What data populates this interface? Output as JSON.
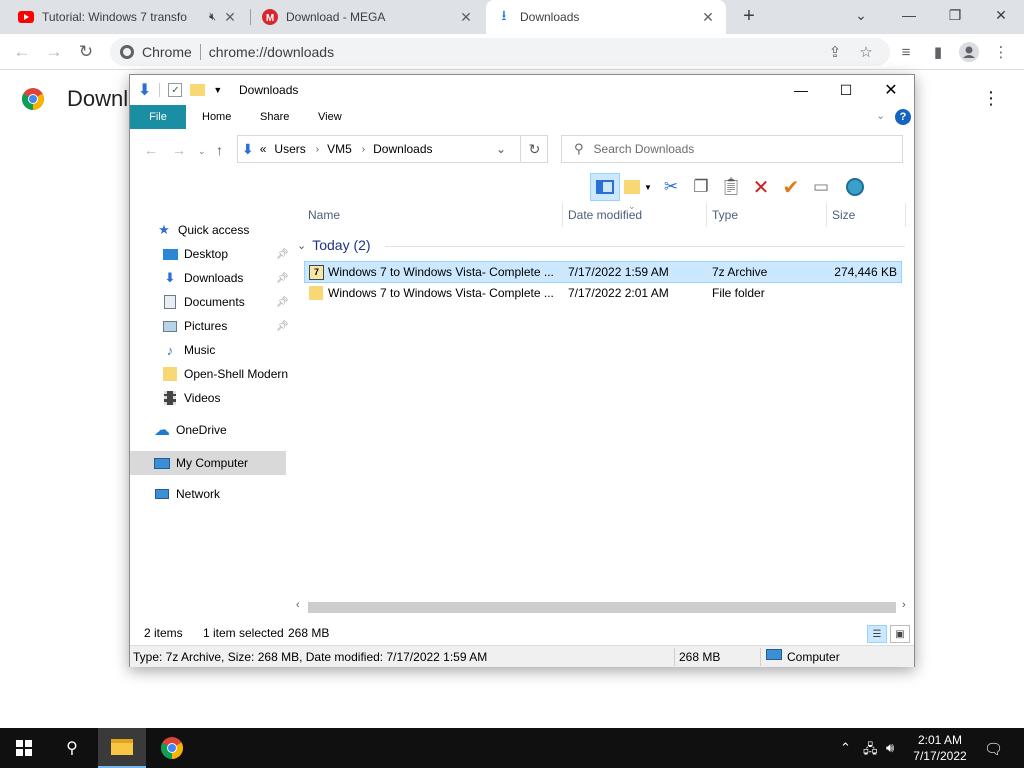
{
  "browser": {
    "tabs": [
      {
        "title": "Tutorial: Windows 7 transfo",
        "icon": "youtube-icon",
        "muted": true
      },
      {
        "title": "Download - MEGA",
        "icon": "mega-icon"
      },
      {
        "title": "Downloads",
        "icon": "download-icon",
        "active": true
      }
    ],
    "omnibox": {
      "site": "Chrome",
      "url": "chrome://downloads"
    },
    "page_title": "Downl"
  },
  "explorer": {
    "title": "Downloads",
    "ribbon_tabs": [
      "File",
      "Home",
      "Share",
      "View"
    ],
    "address": {
      "crumb_prefix": "«",
      "crumbs": [
        "Users",
        "VM5",
        "Downloads"
      ]
    },
    "search_placeholder": "Search Downloads",
    "nav": {
      "quick_access": "Quick access",
      "items": [
        {
          "label": "Desktop",
          "icon": "desktop-icon",
          "pinned": true
        },
        {
          "label": "Downloads",
          "icon": "downloads-folder-icon",
          "pinned": true
        },
        {
          "label": "Documents",
          "icon": "documents-icon",
          "pinned": true
        },
        {
          "label": "Pictures",
          "icon": "pictures-icon",
          "pinned": true
        },
        {
          "label": "Music",
          "icon": "music-icon"
        },
        {
          "label": "Open-Shell Modern",
          "icon": "folder-icon"
        },
        {
          "label": "Videos",
          "icon": "videos-icon"
        }
      ],
      "onedrive": "OneDrive",
      "computer": "My Computer",
      "network": "Network"
    },
    "columns": [
      "Name",
      "Date modified",
      "Type",
      "Size"
    ],
    "group": "Today (2)",
    "files": [
      {
        "name": "Windows 7 to Windows Vista- Complete ...",
        "date": "7/17/2022 1:59 AM",
        "type": "7z Archive",
        "size": "274,446 KB",
        "selected": true
      },
      {
        "name": "Windows 7 to Windows Vista- Complete ...",
        "date": "7/17/2022 2:01 AM",
        "type": "File folder",
        "size": ""
      }
    ],
    "status": {
      "count": "2 items",
      "selected": "1 item selected",
      "selected_size": "268 MB"
    },
    "details": {
      "text": "Type: 7z Archive, Size: 268 MB, Date modified: 7/17/2022 1:59 AM",
      "size": "268 MB",
      "location": "Computer"
    }
  },
  "taskbar": {
    "time": "2:01 AM",
    "date": "7/17/2022"
  },
  "colors": {
    "ribbon_file": "#1a8fa3",
    "selection": "#cce8ff",
    "taskbar": "#101010"
  }
}
